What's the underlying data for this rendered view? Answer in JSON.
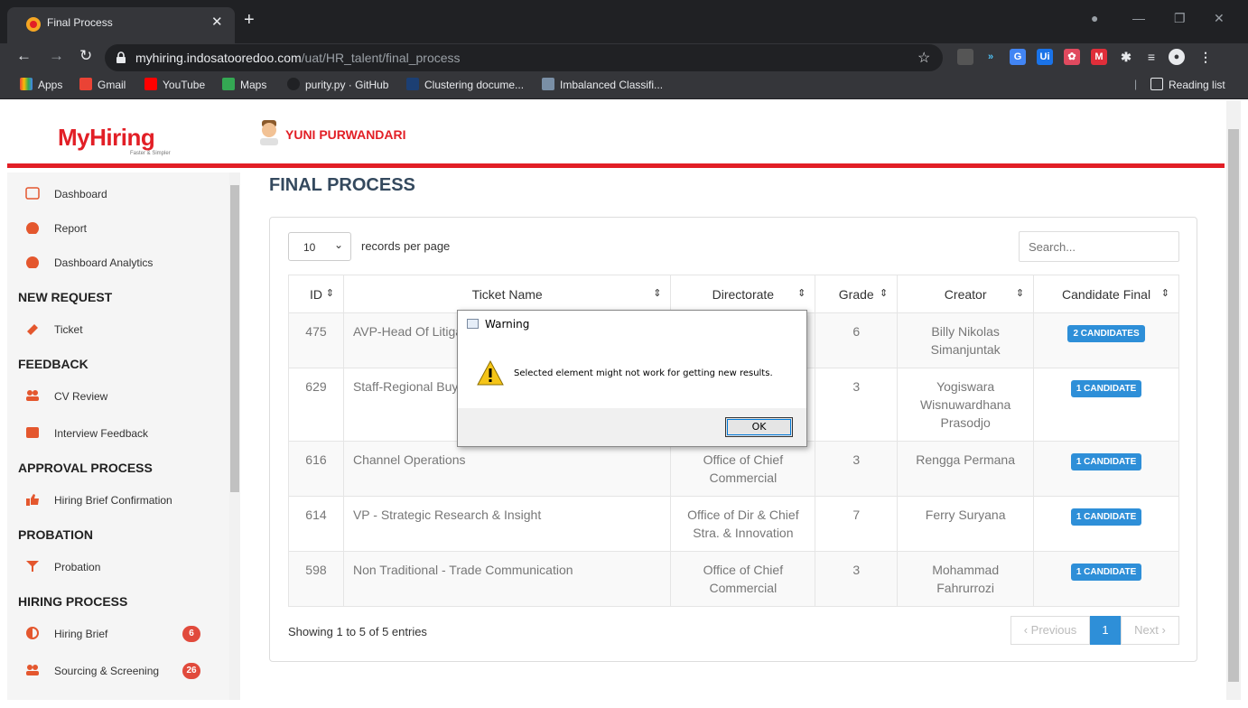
{
  "browser": {
    "tab_title": "Final Process",
    "url_host": "myhiring.indosatooredoo.com",
    "url_path": "/uat/HR_talent/final_process",
    "bookmarks": [
      "Apps",
      "Gmail",
      "YouTube",
      "Maps",
      "purity.py · GitHub",
      "Clustering docume...",
      "Imbalanced Classifi..."
    ],
    "reading_list": "Reading list"
  },
  "header": {
    "logo_text": "MyHiring",
    "logo_tagline": "Faster & Simpler",
    "user_name": "YUNI PURWANDARI"
  },
  "sidebar": {
    "items": {
      "dashboard": "Dashboard",
      "report": "Report",
      "analytics": "Dashboard Analytics",
      "ticket": "Ticket",
      "cv_review": "CV Review",
      "interview_feedback": "Interview Feedback",
      "hiring_brief_confirmation": "Hiring Brief Confirmation",
      "probation": "Probation",
      "hiring_brief": "Hiring Brief",
      "sourcing": "Sourcing & Screening"
    },
    "sections": {
      "new_request": "NEW REQUEST",
      "feedback": "FEEDBACK",
      "approval": "APPROVAL PROCESS",
      "probation": "PROBATION",
      "hiring": "HIRING PROCESS"
    },
    "badges": {
      "hiring_brief": "6",
      "sourcing": "26"
    }
  },
  "main": {
    "title": "FINAL PROCESS",
    "length_value": "10",
    "length_label": "records per page",
    "search_placeholder": "Search...",
    "columns": [
      "ID",
      "Ticket Name",
      "Directorate",
      "Grade",
      "Creator",
      "Candidate Final"
    ],
    "rows": [
      {
        "id": "475",
        "name": "AVP-Head Of Litigation",
        "directorate": "",
        "grade": "6",
        "creator": "Billy Nikolas Simanjuntak",
        "candidates": "2 CANDIDATES"
      },
      {
        "id": "629",
        "name": "Staff-Regional Buyer",
        "directorate": "",
        "grade": "3",
        "creator": "Yogiswara Wisnuwardhana Prasodjo",
        "candidates": "1 CANDIDATE"
      },
      {
        "id": "616",
        "name": "Channel Operations",
        "directorate": "Office of Chief Commercial",
        "grade": "3",
        "creator": "Rengga Permana",
        "candidates": "1 CANDIDATE"
      },
      {
        "id": "614",
        "name": "VP - Strategic Research & Insight",
        "directorate": "Office of Dir & Chief Stra. & Innovation",
        "grade": "7",
        "creator": "Ferry Suryana",
        "candidates": "1 CANDIDATE"
      },
      {
        "id": "598",
        "name": "Non Traditional - Trade Communication",
        "directorate": "Office of Chief Commercial",
        "grade": "3",
        "creator": "Mohammad Fahrurrozi",
        "candidates": "1 CANDIDATE"
      }
    ],
    "info": "Showing 1 to 5 of 5 entries",
    "pager": {
      "prev": "‹ Previous",
      "page": "1",
      "next": "Next ›"
    }
  },
  "dialog": {
    "title": "Warning",
    "message": "Selected element might not work for getting new results.",
    "ok": "OK"
  },
  "colors": {
    "brand": "#e21f26",
    "primary": "#2e8fd8",
    "badge": "#e14a3c"
  }
}
